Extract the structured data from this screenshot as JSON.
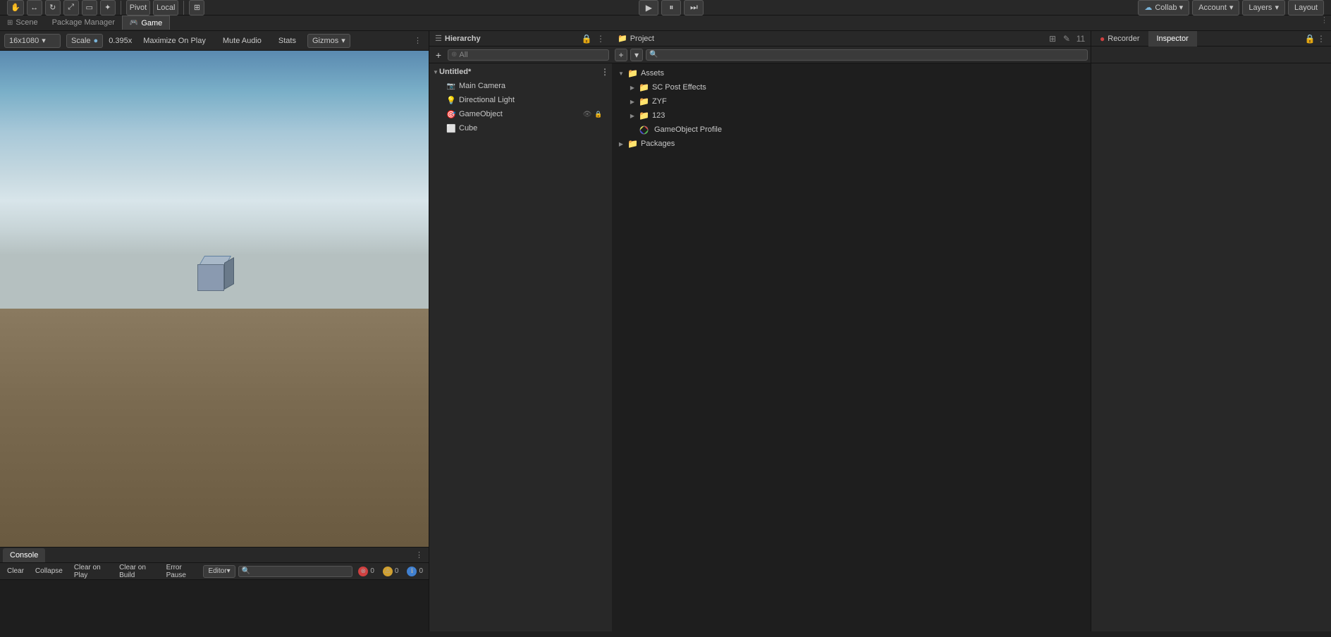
{
  "toolbar": {
    "pivot_label": "Pivot",
    "local_label": "Local",
    "play_btn": "▶",
    "pause_btn": "⏸",
    "step_btn": "⏭",
    "collab_label": "Collab ▾",
    "account_label": "Account",
    "layers_label": "Layers",
    "layout_label": "Layout"
  },
  "menu": {
    "items": [
      "Scene",
      "Package Manager",
      "Game"
    ]
  },
  "game_view": {
    "tab_label": "Game",
    "resolution": "16x1080",
    "scale_label": "Scale",
    "scale_value": "0.395x",
    "maximize_on_play": "Maximize On Play",
    "mute_audio": "Mute Audio",
    "stats": "Stats",
    "gizmos": "Gizmos"
  },
  "hierarchy": {
    "title": "Hierarchy",
    "search_placeholder": "All",
    "scene_name": "Untitled*",
    "items": [
      {
        "name": "Main Camera",
        "type": "camera",
        "indent": 1
      },
      {
        "name": "Directional Light",
        "type": "light",
        "indent": 1
      },
      {
        "name": "GameObject",
        "type": "gameobject",
        "indent": 1,
        "selected": true
      },
      {
        "name": "Cube",
        "type": "cube",
        "indent": 1
      }
    ]
  },
  "project": {
    "title": "Project",
    "assets_label": "Assets",
    "items": [
      {
        "name": "SC Post Effects",
        "type": "folder",
        "indent": 1
      },
      {
        "name": "ZYF",
        "type": "folder",
        "indent": 1
      },
      {
        "name": "123",
        "type": "folder",
        "indent": 1
      },
      {
        "name": "GameObject Profile",
        "type": "profile",
        "indent": 1
      }
    ],
    "packages_label": "Packages"
  },
  "inspector": {
    "title": "Inspector"
  },
  "recorder": {
    "title": "Recorder"
  },
  "console": {
    "title": "Console",
    "buttons": {
      "clear": "Clear",
      "collapse": "Collapse",
      "clear_on_play": "Clear on Play",
      "clear_on_build": "Clear on Build",
      "error_pause": "Error Pause",
      "editor_dropdown": "Editor"
    },
    "badges": {
      "error_count": "0",
      "warn_count": "0",
      "info_count": "0"
    }
  }
}
